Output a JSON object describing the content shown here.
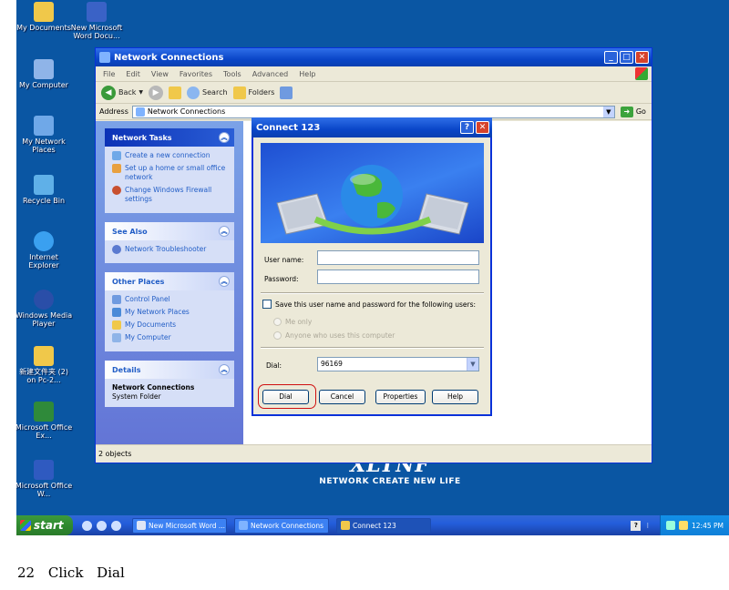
{
  "desktop": {
    "icons": [
      {
        "label": "My Documents",
        "color": "#f0c84a"
      },
      {
        "label": "New Microsoft Word Docu...",
        "color": "#3a62c6"
      },
      {
        "label": "My Computer",
        "color": "#8fb4e8"
      },
      {
        "label": "My Network Places",
        "color": "#6fa8e8"
      },
      {
        "label": "Recycle Bin",
        "color": "#5fb0e8"
      },
      {
        "label": "Internet Explorer",
        "color": "#3aa0f0"
      },
      {
        "label": "Windows Media Player",
        "color": "#2a4ea8"
      },
      {
        "label": "新建文件夹 (2) on Pc-2...",
        "color": "#f0c84a"
      },
      {
        "label": "Microsoft Office Ex...",
        "color": "#2f8a3a"
      },
      {
        "label": "Microsoft Office W...",
        "color": "#2f5ac0"
      }
    ],
    "brand_logo": "XLTNF",
    "brand_tagline": "NETWORK CREATE NEW LIFE"
  },
  "explorer": {
    "title": "Network Connections",
    "menu": [
      "File",
      "Edit",
      "View",
      "Favorites",
      "Tools",
      "Advanced",
      "Help"
    ],
    "toolbar": {
      "back": "Back",
      "search": "Search",
      "folders": "Folders"
    },
    "address_label": "Address",
    "address_value": "Network Connections",
    "go_label": "Go",
    "network_tasks": {
      "title": "Network Tasks",
      "items": [
        "Create a new connection",
        "Set up a home or small office network",
        "Change Windows Firewall settings"
      ]
    },
    "see_also": {
      "title": "See Also",
      "items": [
        "Network Troubleshooter"
      ]
    },
    "other_places": {
      "title": "Other Places",
      "items": [
        "Control Panel",
        "My Network Places",
        "My Documents",
        "My Computer"
      ]
    },
    "details": {
      "title": "Details",
      "name": "Network Connections",
      "type": "System Folder"
    },
    "status": "2 objects"
  },
  "dialog": {
    "title": "Connect 123",
    "user_name_label": "User name:",
    "password_label": "Password:",
    "save_checkbox_label": "Save this user name and password for the following users:",
    "radio_me_only": "Me only",
    "radio_anyone": "Anyone who uses this computer",
    "dial_label": "Dial:",
    "dial_value": "96169",
    "buttons": {
      "dial": "Dial",
      "cancel": "Cancel",
      "properties": "Properties",
      "help": "Help"
    }
  },
  "taskbar": {
    "start": "start",
    "buttons": [
      "New Microsoft Word ...",
      "Network Connections",
      "Connect 123"
    ],
    "clock": "12:45 PM"
  },
  "caption": "22 Click Dial",
  "colors": {
    "desktop": "#0a56a3",
    "title_blue": "#0a46c8",
    "highlight": "#d01010"
  }
}
